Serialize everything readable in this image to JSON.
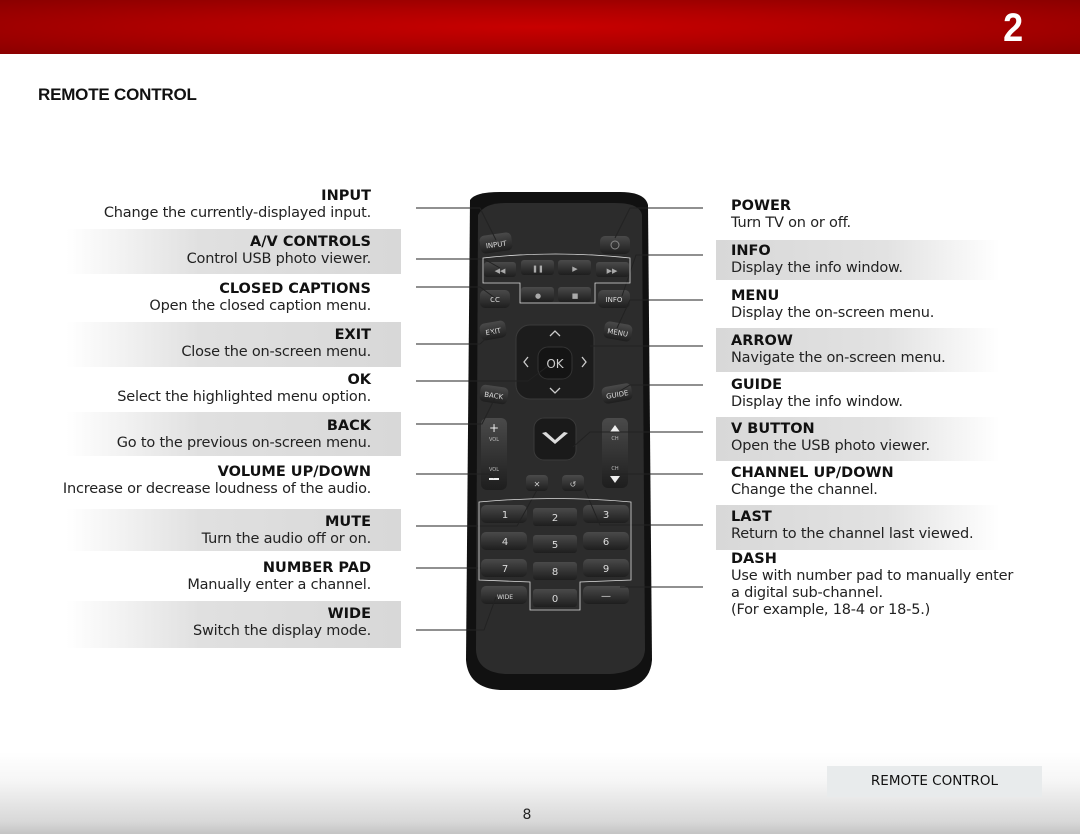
{
  "header": {
    "chapter_number": "2"
  },
  "page_title": "REMOTE CONTROL",
  "left_items": [
    {
      "title": "INPUT",
      "desc": "Change the currently-displayed input."
    },
    {
      "title": "A/V CONTROLS",
      "desc": "Control USB photo viewer."
    },
    {
      "title": "CLOSED CAPTIONS",
      "desc": "Open the closed caption menu."
    },
    {
      "title": "EXIT",
      "desc": "Close the on-screen menu."
    },
    {
      "title": "OK",
      "desc": "Select the highlighted menu option."
    },
    {
      "title": "BACK",
      "desc": "Go to the previous on-screen menu."
    },
    {
      "title": "VOLUME UP/DOWN",
      "desc": "Increase or decrease loudness of the audio."
    },
    {
      "title": "MUTE",
      "desc": "Turn the audio off or on."
    },
    {
      "title": "NUMBER PAD",
      "desc": "Manually enter a channel."
    },
    {
      "title": "WIDE",
      "desc": "Switch the display mode."
    }
  ],
  "right_items": [
    {
      "title": "POWER",
      "desc": "Turn TV on or off."
    },
    {
      "title": "INFO",
      "desc": "Display the info window."
    },
    {
      "title": "MENU",
      "desc": "Display the on-screen menu."
    },
    {
      "title": "ARROW",
      "desc": "Navigate the on-screen menu."
    },
    {
      "title": "GUIDE",
      "desc": "Display the info window."
    },
    {
      "title": "V BUTTON",
      "desc": "Open the USB photo viewer."
    },
    {
      "title": "CHANNEL UP/DOWN",
      "desc": "Change the channel."
    },
    {
      "title": "LAST",
      "desc": "Return to the channel last viewed."
    },
    {
      "title": "DASH",
      "desc": "Use with number pad to manually enter a digital sub-channel.",
      "desc2": "(For example, 18-4 or 18-5.)"
    }
  ],
  "remote": {
    "input": "INPUT",
    "cc": "CC",
    "info": "INFO",
    "exit": "EXIT",
    "menu": "MENU",
    "ok": "OK",
    "back": "BACK",
    "guide": "GUIDE",
    "vol": "VOL",
    "ch": "CH",
    "wide": "WIDE",
    "keys": [
      "1",
      "2",
      "3",
      "4",
      "5",
      "6",
      "7",
      "8",
      "9",
      "0"
    ],
    "dash": "—"
  },
  "footer": {
    "section_label": "REMOTE CONTROL",
    "page_number": "8"
  }
}
